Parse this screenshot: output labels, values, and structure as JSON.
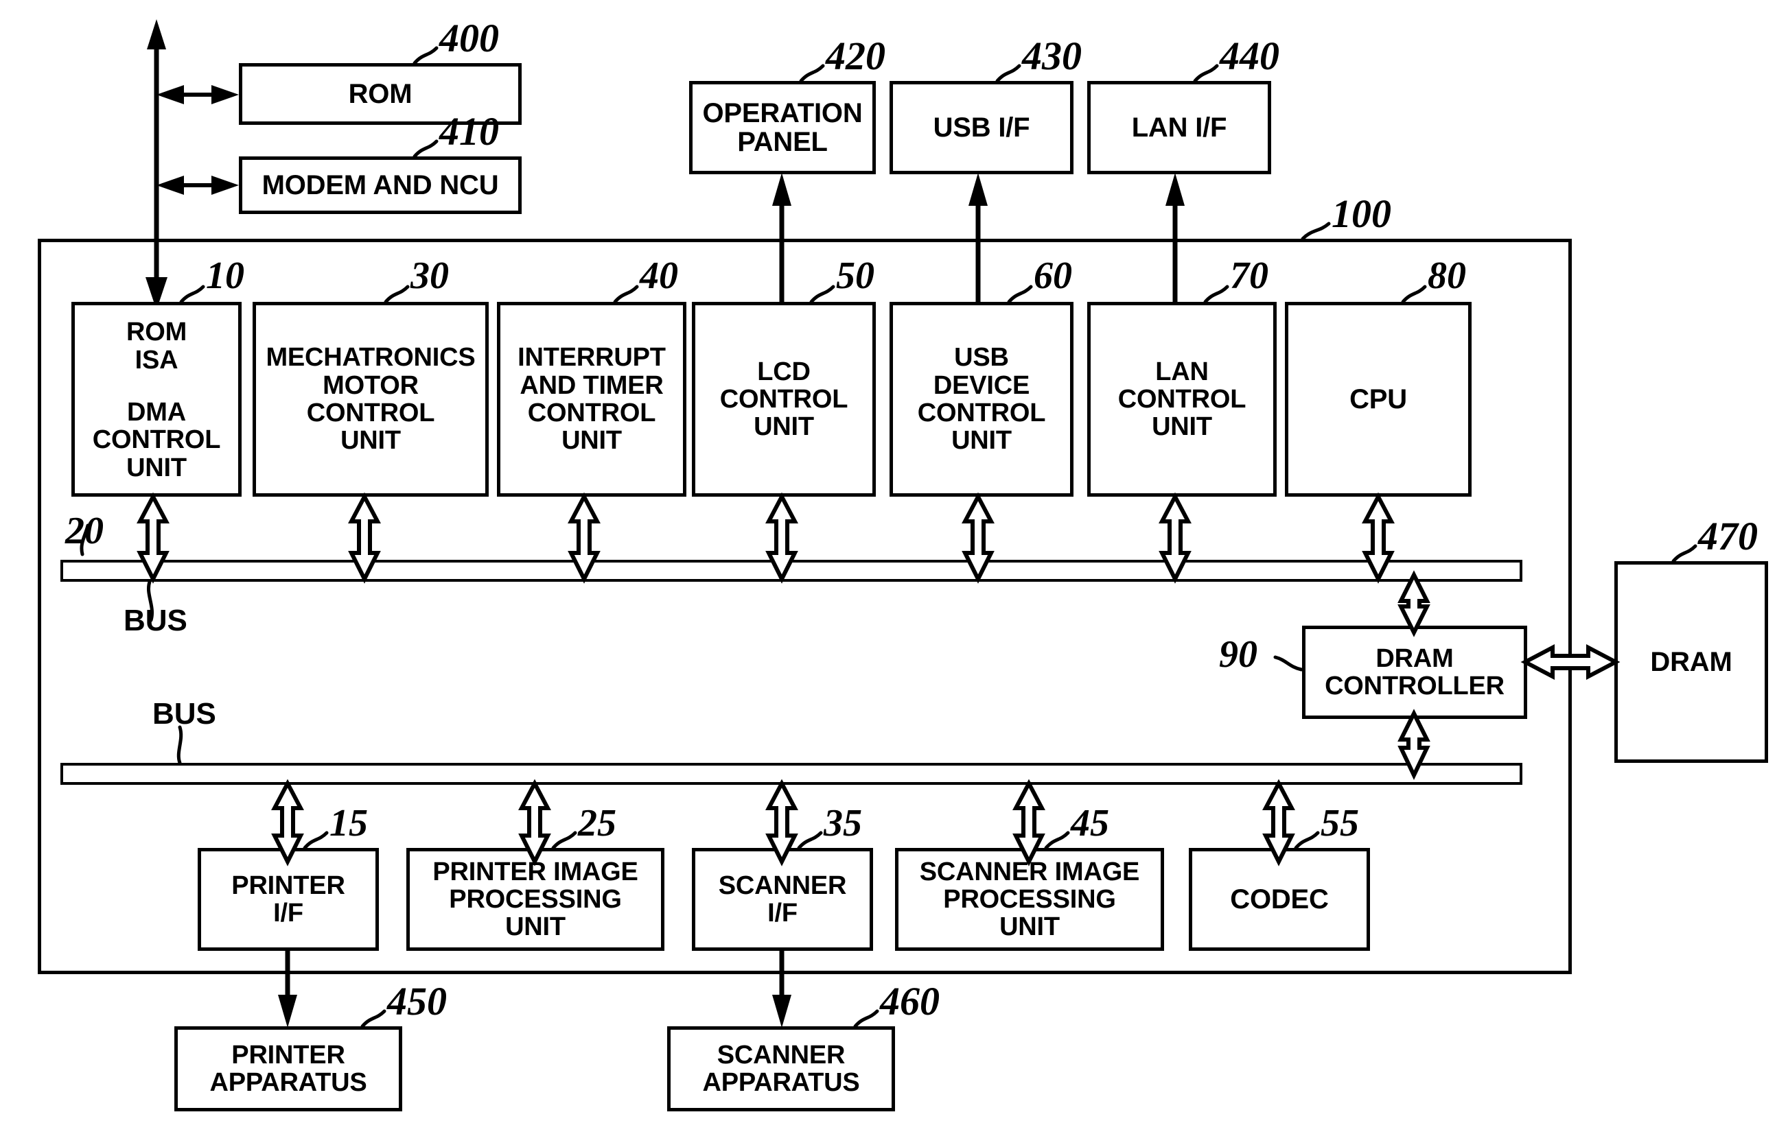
{
  "diagram": {
    "title": "Image forming apparatus controller block diagram",
    "external_top": [
      {
        "id": "rom-ext",
        "label": "ROM",
        "ref": "400"
      },
      {
        "id": "modem-ncu",
        "label": "MODEM AND NCU",
        "ref": "410"
      },
      {
        "id": "operation-panel",
        "label": "OPERATION\nPANEL",
        "ref": "420"
      },
      {
        "id": "usb-if",
        "label": "USB I/F",
        "ref": "430"
      },
      {
        "id": "lan-if",
        "label": "LAN I/F",
        "ref": "440"
      }
    ],
    "chip": {
      "ref": "100"
    },
    "control_units": [
      {
        "id": "rom-isa",
        "label": "ROM\nISA",
        "ref": "10"
      },
      {
        "id": "dma-control-unit",
        "label": "DMA\nCONTROL\nUNIT",
        "ref": ""
      },
      {
        "id": "mechatronics-motor-control-unit",
        "label": "MECHATRONICS\nMOTOR\nCONTROL\nUNIT",
        "ref": "30"
      },
      {
        "id": "interrupt-and-timer-control-unit",
        "label": "INTERRUPT\nAND TIMER\nCONTROL\nUNIT",
        "ref": "40"
      },
      {
        "id": "lcd-control-unit",
        "label": "LCD\nCONTROL\nUNIT",
        "ref": "50"
      },
      {
        "id": "usb-device-control-unit",
        "label": "USB\nDEVICE\nCONTROL\nUNIT",
        "ref": "60"
      },
      {
        "id": "lan-control-unit",
        "label": "LAN\nCONTROL\nUNIT",
        "ref": "70"
      },
      {
        "id": "cpu",
        "label": "CPU",
        "ref": "80"
      }
    ],
    "buses": [
      {
        "id": "bus-upper",
        "label": "BUS",
        "ref": "20"
      },
      {
        "id": "bus-lower",
        "label": "BUS",
        "ref": ""
      }
    ],
    "memory": [
      {
        "id": "dram-controller",
        "label": "DRAM\nCONTROLLER",
        "ref": "90"
      },
      {
        "id": "dram",
        "label": "DRAM",
        "ref": "470"
      }
    ],
    "peripheral_units": [
      {
        "id": "printer-if",
        "label": "PRINTER\nI/F",
        "ref": "15"
      },
      {
        "id": "printer-image-processing-unit",
        "label": "PRINTER IMAGE\nPROCESSING\nUNIT",
        "ref": "25"
      },
      {
        "id": "scanner-if",
        "label": "SCANNER\nI/F",
        "ref": "35"
      },
      {
        "id": "scanner-image-processing-unit",
        "label": "SCANNER IMAGE\nPROCESSING\nUNIT",
        "ref": "45"
      },
      {
        "id": "codec",
        "label": "CODEC",
        "ref": "55"
      }
    ],
    "apparatus": [
      {
        "id": "printer-apparatus",
        "label": "PRINTER\nAPPARATUS",
        "ref": "450"
      },
      {
        "id": "scanner-apparatus",
        "label": "SCANNER\nAPPARATUS",
        "ref": "460"
      }
    ],
    "colors": {
      "line": "#000000",
      "fill": "#ffffff"
    }
  }
}
